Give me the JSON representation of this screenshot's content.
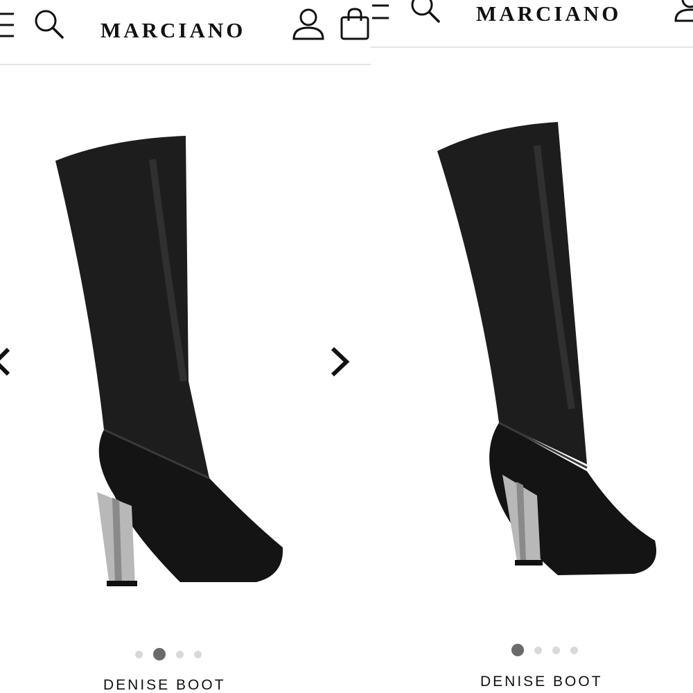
{
  "left_panel": {
    "header": {
      "brand": "MARCIANO",
      "icons": [
        "menu-icon",
        "search-icon",
        "account-icon",
        "shopping-bag-icon"
      ]
    },
    "product": {
      "name": "DENISE BOOT",
      "image": "black-knee-high-boot-side-view",
      "carousel": {
        "total": 4,
        "active": 2
      }
    },
    "nav_icons": [
      "chevron-left-icon",
      "chevron-right-icon"
    ]
  },
  "right_panel": {
    "header": {
      "brand": "MARCIANO",
      "icons": [
        "menu-icon",
        "search-icon",
        "account-icon"
      ]
    },
    "product": {
      "name": "DENISE BOOT",
      "image": "black-knee-high-boot-angled-view",
      "carousel": {
        "total": 4,
        "active": 1
      }
    }
  },
  "colors": {
    "text": "#111111",
    "divider": "#e4e4e4",
    "dot_active": "#6a6a6a",
    "dot_inactive": "#d9d9d9",
    "heel": "#b8b8b8"
  }
}
